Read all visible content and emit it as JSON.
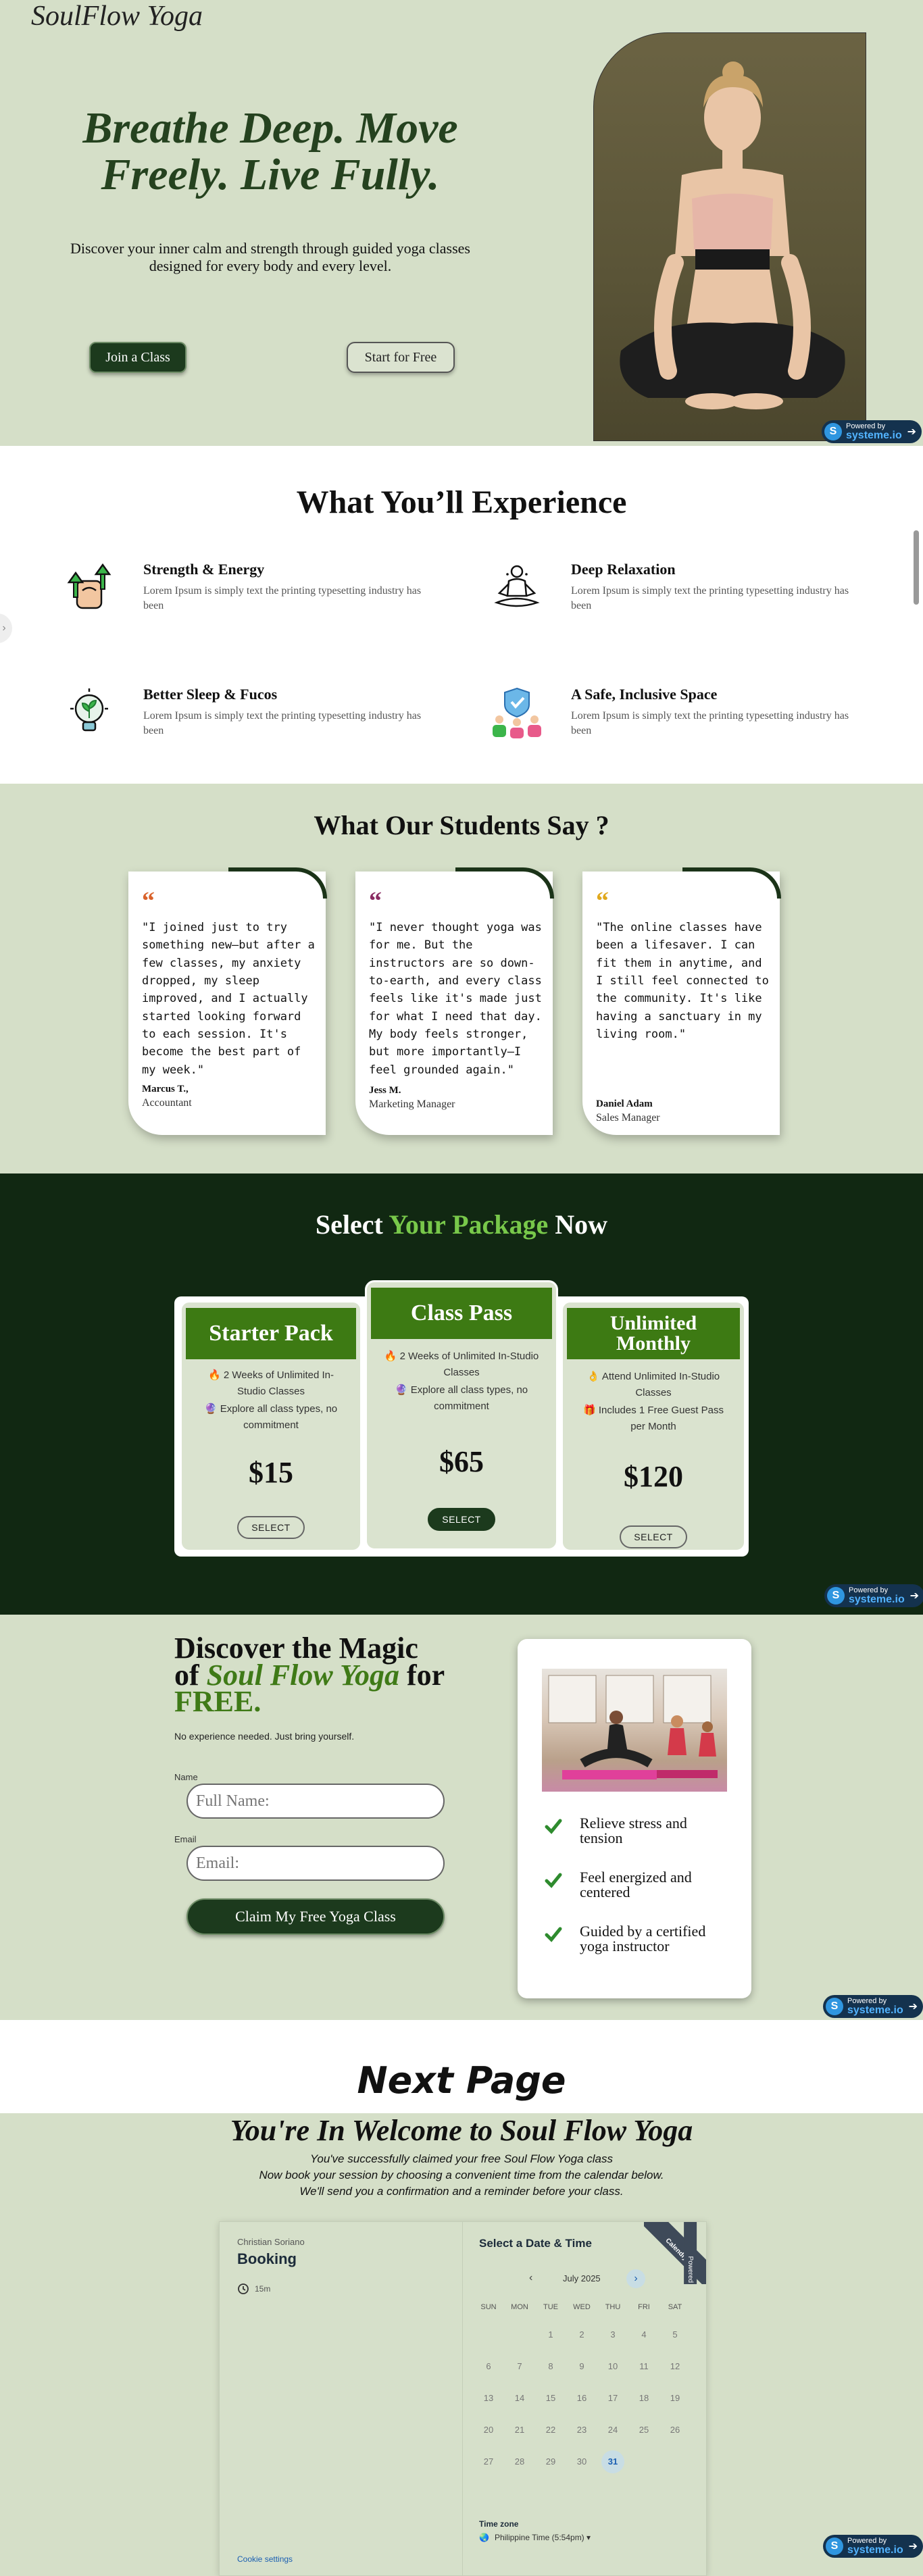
{
  "hero": {
    "logo": "SoulFlow Yoga",
    "title": "Breathe Deep. Move Freely. Live Fully.",
    "subtitle": "Discover your inner calm and strength through guided yoga classes designed for every body and every level.",
    "join_label": "Join a Class",
    "start_label": "Start for Free"
  },
  "badge": {
    "line1": "Powered by",
    "line2": "systeme.io"
  },
  "experience": {
    "title": "What You’ll Experience",
    "features": [
      {
        "title": "Strength & Energy",
        "text": "Lorem Ipsum is simply text the printing typesetting industry has been",
        "icon": "strength-icon"
      },
      {
        "title": "Deep Relaxation",
        "text": "Lorem Ipsum is simply text the printing typesetting industry has been",
        "icon": "meditation-icon"
      },
      {
        "title": "Better Sleep & Fucos",
        "text": "Lorem Ipsum is simply text the printing typesetting industry has been",
        "icon": "lightbulb-icon"
      },
      {
        "title": "A Safe, Inclusive Space",
        "text": "Lorem Ipsum is simply text the printing typesetting industry has been",
        "icon": "shield-people-icon"
      }
    ]
  },
  "testimonials": {
    "title": "What Our Students Say ?",
    "items": [
      {
        "quote_mark": "“",
        "text": "\"I joined just to try something new—but after a few classes, my anxiety dropped, my sleep improved, and I actually started looking forward to each session. It's become the best part of my week.\"",
        "name": "Marcus T.,",
        "role": "Accountant",
        "color": "#d9622b"
      },
      {
        "quote_mark": "“",
        "text": "\"I never thought yoga was for me. But the instructors are so down-to-earth, and every class feels like it's made just for what I need that day. My body feels stronger, but more importantly—I feel grounded again.\"",
        "name": "Jess M.",
        "role": "Marketing Manager",
        "color": "#8a2b62"
      },
      {
        "quote_mark": "“",
        "text": "\"The online classes have been a lifesaver. I can fit them in anytime, and I still feel connected to the community. It's like having a sanctuary in my living room.\"",
        "name": "Daniel Adam",
        "role": "Sales Manager",
        "color": "#e0a81c"
      }
    ]
  },
  "pricing": {
    "title_pre": "Select",
    "title_highlight": "Your Package",
    "title_post": "Now",
    "plans": [
      {
        "name": "Starter Pack",
        "f1_icon": "🔥",
        "f1": "2 Weeks of Unlimited In-Studio Classes",
        "f2_icon": "🔮",
        "f2": "Explore all class types, no commitment",
        "price": "$15",
        "select": "SELECT"
      },
      {
        "name": "Class Pass",
        "f1_icon": "🔥",
        "f1": "2 Weeks of Unlimited In-Studio Classes",
        "f2_icon": "🔮",
        "f2": "Explore all class types, no commitment",
        "price": "$65",
        "select": "SELECT"
      },
      {
        "name": "Unlimited Monthly",
        "f1_icon": "👌",
        "f1": "Attend Unlimited In-Studio Classes",
        "f2_icon": "🎁",
        "f2": "Includes 1 Free Guest Pass per Month",
        "price": "$120",
        "select": "SELECT"
      }
    ]
  },
  "signup": {
    "title_line1": "Discover the Magic",
    "title_of": "of",
    "title_brand": "Soul Flow Yoga",
    "title_for": "for",
    "title_free": "FREE.",
    "subtitle": "No experience needed. Just bring yourself.",
    "name_label": "Name",
    "name_placeholder": "Full Name:",
    "email_label": "Email",
    "email_placeholder": "Email:",
    "cta": "Claim My Free Yoga Class",
    "benefits": [
      "Relieve stress and tension",
      "Feel energized and centered",
      "Guided by a certified yoga instructor"
    ]
  },
  "next_page": {
    "title": "Next Page"
  },
  "booking": {
    "title": "You're In Welcome to Soul Flow Yoga",
    "line1": "You've successfully claimed your free Soul Flow Yoga class",
    "line2": "Now book your session by choosing a convenient time from the calendar below.",
    "line3": "We'll send you a confirmation and a reminder before your class.",
    "host": "Christian Soriano",
    "event": "Booking",
    "duration": "15m",
    "cookie": "Cookie settings",
    "select_heading": "Select a Date & Time",
    "month": "July 2025",
    "weekdays": [
      "SUN",
      "MON",
      "TUE",
      "WED",
      "THU",
      "FRI",
      "SAT"
    ],
    "days": [
      "1",
      "2",
      "3",
      "4",
      "5",
      "6",
      "7",
      "8",
      "9",
      "10",
      "11",
      "12",
      "13",
      "14",
      "15",
      "16",
      "17",
      "18",
      "19",
      "20",
      "21",
      "22",
      "23",
      "24",
      "25",
      "26",
      "27",
      "28",
      "29",
      "30",
      "31"
    ],
    "selected_day": "31",
    "timezone_label": "Time zone",
    "timezone": "Philippine Time (5:54pm) ▾",
    "corner_line1": "Powered by",
    "corner_line2": "Calendly"
  }
}
